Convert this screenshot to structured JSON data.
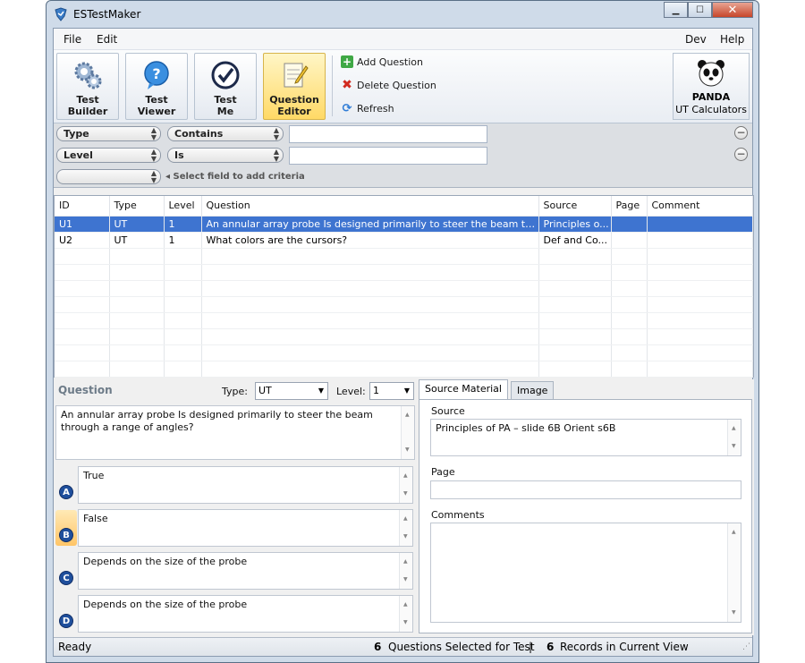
{
  "app": {
    "title": "ESTestMaker"
  },
  "window_controls": {
    "minimize": "▁",
    "maximize": "☐",
    "close": "✕"
  },
  "menu": {
    "file": "File",
    "edit": "Edit",
    "dev": "Dev",
    "help": "Help"
  },
  "ribbon": {
    "test_builder": {
      "line1": "Test",
      "line2": "Builder"
    },
    "test_viewer": {
      "line1": "Test",
      "line2": "Viewer"
    },
    "test_me": {
      "line1": "Test",
      "line2": "Me"
    },
    "question_editor": {
      "line1": "Question",
      "line2": "Editor"
    },
    "add_question": "Add Question",
    "delete_question": "Delete Question",
    "refresh": "Refresh",
    "panda": {
      "line1": "PANDA",
      "line2": "UT Calculators"
    }
  },
  "filters": {
    "row1": {
      "field": "Type",
      "operator": "Contains",
      "value": ""
    },
    "row2": {
      "field": "Level",
      "operator": "Is",
      "value": ""
    },
    "row3": {
      "field": "",
      "hint": "◂ Select field to add criteria"
    }
  },
  "grid": {
    "columns": [
      "ID",
      "Type",
      "Level",
      "Question",
      "Source",
      "Page",
      "Comment"
    ],
    "rows": [
      {
        "id": "U1",
        "type": "UT",
        "level": "1",
        "question": "An annular array probe Is designed primarily to steer the beam thr...",
        "source": "Principles o...",
        "page": "",
        "comment": ""
      },
      {
        "id": "U2",
        "type": "UT",
        "level": "1",
        "question": "What colors are the cursors?",
        "source": "Def and Co...",
        "page": "",
        "comment": ""
      }
    ]
  },
  "editor": {
    "label": "Question",
    "type_label": "Type:",
    "type_value": "UT",
    "level_label": "Level:",
    "level_value": "1",
    "question_text": "An annular array probe Is designed primarily to steer the beam through a range of angles?",
    "answers": [
      {
        "letter": "A",
        "text": "True"
      },
      {
        "letter": "B",
        "text": "False"
      },
      {
        "letter": "C",
        "text": "Depends on the size of the probe"
      },
      {
        "letter": "D",
        "text": "Depends on the size of the probe"
      }
    ]
  },
  "side_panel": {
    "tabs": [
      "Source Material",
      "Image"
    ],
    "source_label": "Source",
    "source_value": "Principles of PA – slide 6B Orient s6B",
    "page_label": "Page",
    "page_value": "",
    "comments_label": "Comments",
    "comments_value": ""
  },
  "status": {
    "ready": "Ready",
    "selected_count": "6",
    "selected_label": "Questions Selected for Test",
    "divider": "|",
    "records_count": "6",
    "records_label": "Records in Current View"
  }
}
